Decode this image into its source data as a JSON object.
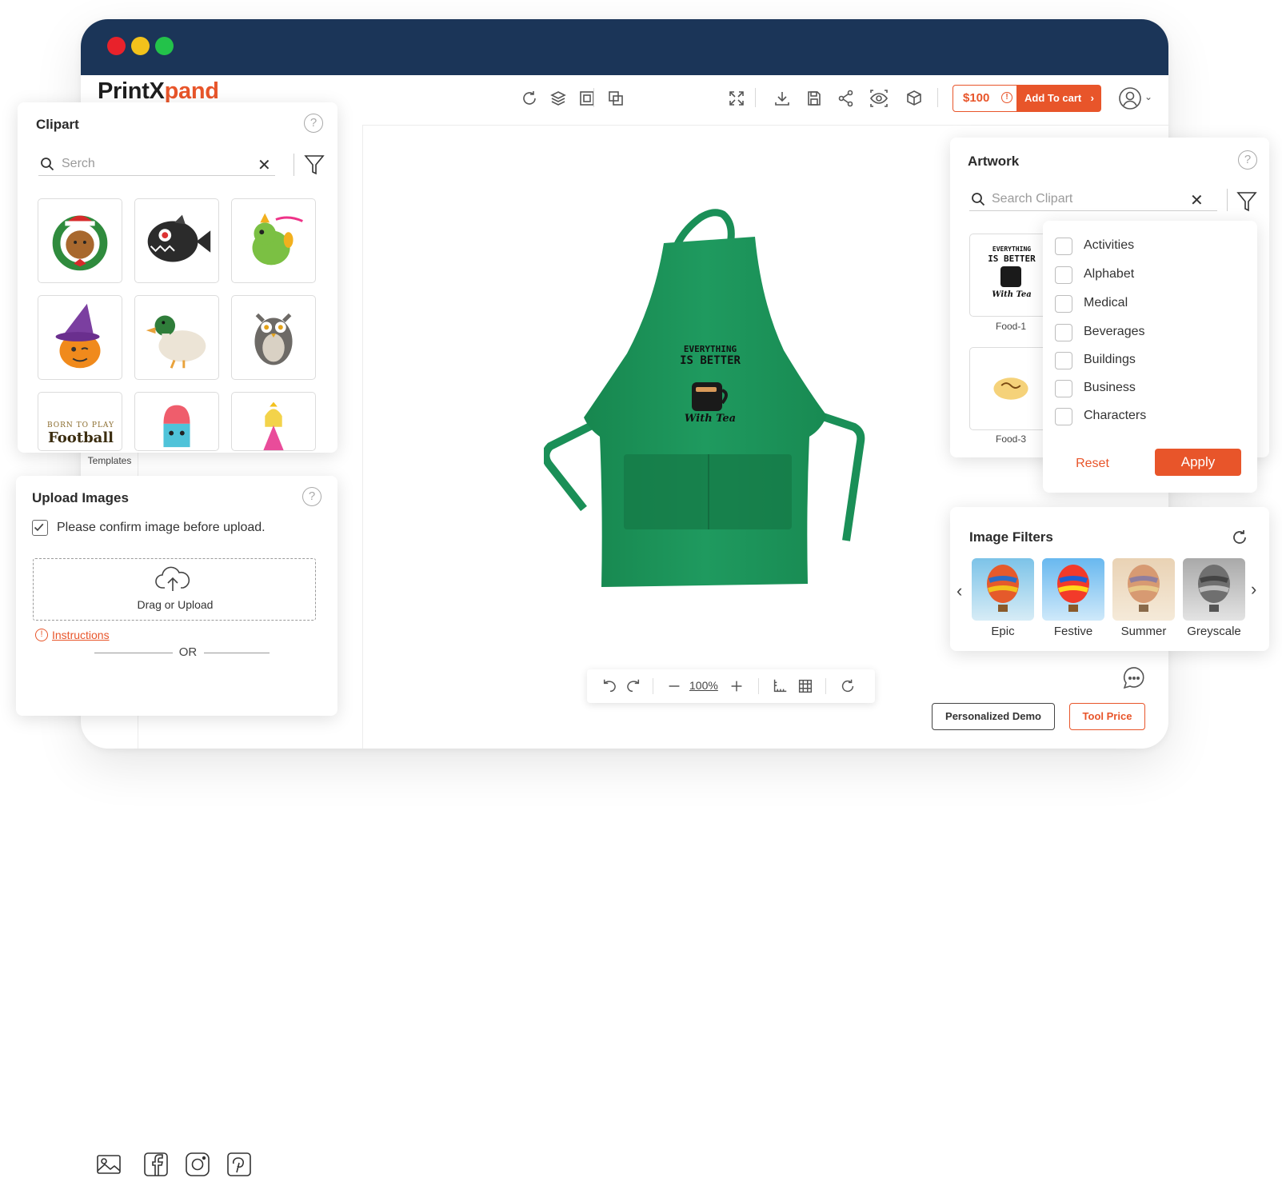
{
  "window": {
    "dots": [
      "#e8222b",
      "#f2c21b",
      "#23c24a"
    ],
    "logo_a": "PrintX",
    "logo_b": "pand"
  },
  "toolbar": {
    "price": "$100",
    "add_to_cart": "Add To cart",
    "icons": [
      "refresh-icon",
      "layers-icon",
      "group-icon",
      "duplicate-icon",
      "fullscreen-icon",
      "download-icon",
      "save-icon",
      "share-icon",
      "preview-icon",
      "3d-box-icon",
      "user-icon"
    ]
  },
  "clipart": {
    "title": "Clipart",
    "search_placeholder": "Serch",
    "items": [
      "bear-wreath",
      "black-piranha",
      "green-dinosaur",
      "witch-pumpkin",
      "duck",
      "owl",
      "born-to-play-football",
      "popsicle",
      "princess"
    ],
    "football_line1": "BORN TO PLAY",
    "football_line2": "Football"
  },
  "rail": {
    "templates": "Templates"
  },
  "upload": {
    "title": "Upload Images",
    "confirm": "Please confirm image before upload.",
    "drag": "Drag or Upload",
    "instructions": "Instructions",
    "or": "OR",
    "sources": [
      "gallery-icon",
      "facebook-icon",
      "instagram-icon",
      "pinterest-icon"
    ]
  },
  "canvas": {
    "apron_color": "#1f9a5f",
    "print_line1": "EVERYTHING",
    "print_line2": "IS BETTER",
    "print_line3": "With Tea",
    "zoom": "100%"
  },
  "artwork": {
    "title": "Artwork",
    "search_placeholder": "Search Clipart",
    "items": [
      {
        "label": "Food-1"
      },
      {
        "label": "Food-3"
      }
    ],
    "mini_line1": "EVERYTHING",
    "mini_line2": "IS BETTER",
    "mini_line3": "With Tea"
  },
  "categories": {
    "items": [
      "Activities",
      "Alphabet",
      "Medical",
      "Beverages",
      "Buildings",
      "Business",
      "Characters"
    ],
    "reset": "Reset",
    "apply": "Apply"
  },
  "image_filters": {
    "title": "Image Filters",
    "items": [
      "Epic",
      "Festive",
      "Summer",
      "Greyscale"
    ]
  },
  "footer": {
    "demo": "Personalized Demo",
    "tool_price": "Tool Price"
  },
  "colors": {
    "accent": "#e8552a",
    "titlebar": "#1b3558"
  }
}
